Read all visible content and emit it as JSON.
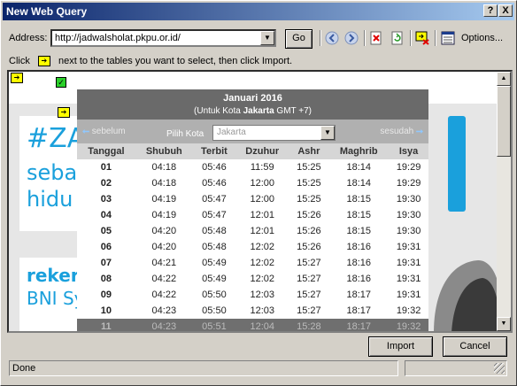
{
  "window": {
    "title": "New Web Query"
  },
  "titlebar_buttons": {
    "help": "?",
    "close": "X"
  },
  "toolbar": {
    "address_label": "Address:",
    "address_value": "http://jadwalsholat.pkpu.or.id/",
    "go_label": "Go",
    "options_label": "Options..."
  },
  "hint": {
    "before": "Click",
    "after": "next to the tables you want to select, then click Import."
  },
  "banners": {
    "zakat_line1": "#ZA",
    "zakat_line2": "seba",
    "zakat_line3": "hidu",
    "bni_line1": "reker",
    "bni_line2": "BNI Sy"
  },
  "calendar": {
    "title": "Januari 2016",
    "subtitle_prefix": "(Untuk Kota ",
    "subtitle_city": "Jakarta",
    "subtitle_suffix": " GMT +7)",
    "prev": "sebelum",
    "next": "sesudah",
    "pilih_kota": "Pilih Kota",
    "selected_city": "Jakarta",
    "columns": [
      "Tanggal",
      "Shubuh",
      "Terbit",
      "Dzuhur",
      "Ashr",
      "Maghrib",
      "Isya"
    ],
    "rows": [
      [
        "01",
        "04:18",
        "05:46",
        "11:59",
        "15:25",
        "18:14",
        "19:29"
      ],
      [
        "02",
        "04:18",
        "05:46",
        "12:00",
        "15:25",
        "18:14",
        "19:29"
      ],
      [
        "03",
        "04:19",
        "05:47",
        "12:00",
        "15:25",
        "18:15",
        "19:30"
      ],
      [
        "04",
        "04:19",
        "05:47",
        "12:01",
        "15:26",
        "18:15",
        "19:30"
      ],
      [
        "05",
        "04:20",
        "05:48",
        "12:01",
        "15:26",
        "18:15",
        "19:30"
      ],
      [
        "06",
        "04:20",
        "05:48",
        "12:02",
        "15:26",
        "18:16",
        "19:31"
      ],
      [
        "07",
        "04:21",
        "05:49",
        "12:02",
        "15:27",
        "18:16",
        "19:31"
      ],
      [
        "08",
        "04:22",
        "05:49",
        "12:02",
        "15:27",
        "18:16",
        "19:31"
      ],
      [
        "09",
        "04:22",
        "05:50",
        "12:03",
        "15:27",
        "18:17",
        "19:31"
      ],
      [
        "10",
        "04:23",
        "05:50",
        "12:03",
        "15:27",
        "18:17",
        "19:32"
      ],
      [
        "11",
        "04:23",
        "05:51",
        "12:04",
        "15:28",
        "18:17",
        "19:32"
      ]
    ]
  },
  "buttons": {
    "import": "Import",
    "cancel": "Cancel"
  },
  "status": {
    "text": "Done"
  },
  "colors": {
    "title_start": "#0a246a",
    "title_end": "#a6caf0",
    "marker": "#ffff00",
    "checked": "#2ad02a",
    "brand_blue": "#1aa0dc"
  }
}
